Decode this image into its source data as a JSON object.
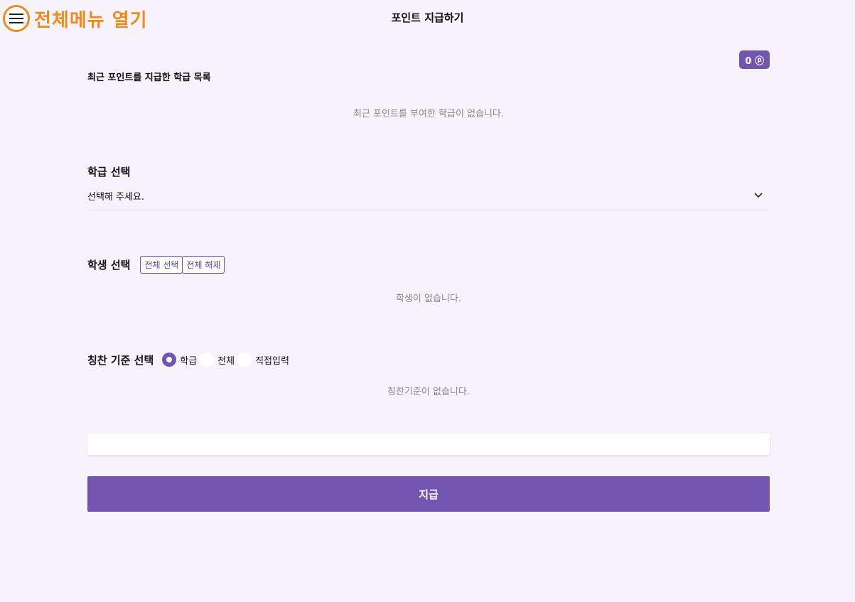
{
  "header": {
    "menu_label": "전체메뉴 열기",
    "title": "포인트 지급하기"
  },
  "points": {
    "badge": "0 ⓟ"
  },
  "recent": {
    "title": "최근 포인트를 지급한 학급 목록",
    "empty": "최근 포인트를 부여한 학급이 없습니다."
  },
  "class_select": {
    "label": "학급 선택",
    "value": "선택해 주세요."
  },
  "students": {
    "label": "학생 선택",
    "select_all": "전체 선택",
    "deselect_all": "전체 해제",
    "empty": "학생이 없습니다."
  },
  "praise": {
    "label": "칭찬 기준 선택",
    "options": [
      {
        "label": "학급",
        "checked": true
      },
      {
        "label": "전체",
        "checked": false
      },
      {
        "label": "직접입력",
        "checked": false
      }
    ],
    "empty": "칭찬기준이 없습니다."
  },
  "comment": {
    "value": "",
    "placeholder": ""
  },
  "submit": {
    "label": "지급"
  },
  "colors": {
    "accent": "#7255b1",
    "menu": "#f08a1c",
    "background": "#f6f3fd"
  }
}
